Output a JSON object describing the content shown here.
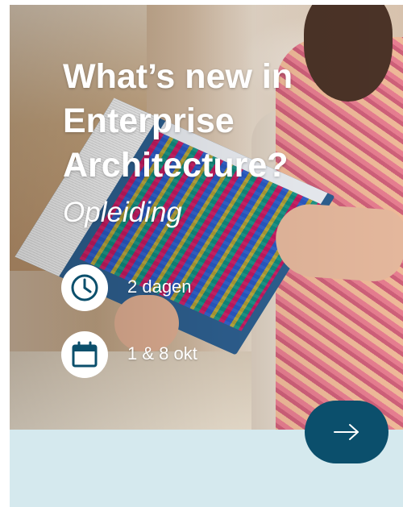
{
  "card": {
    "title": "What’s new in Enterprise Architecture?",
    "subtitle": "Opleiding",
    "duration": {
      "icon": "clock-icon",
      "text": "2 dagen"
    },
    "dates": {
      "icon": "calendar-icon",
      "text": "1 & 8 okt"
    },
    "next_button": {
      "icon": "arrow-right-icon"
    }
  },
  "colors": {
    "accent": "#0b4f6c",
    "footer_background": "#d5e9ee",
    "text": "#ffffff"
  }
}
